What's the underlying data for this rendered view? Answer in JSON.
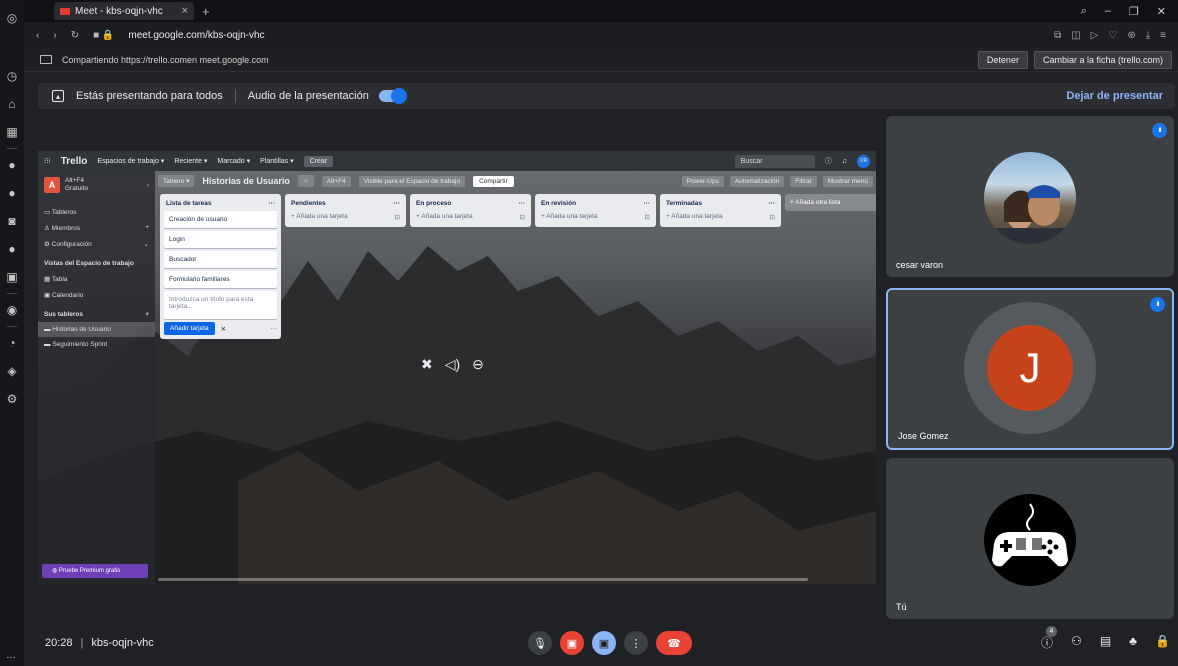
{
  "browser": {
    "tab_title": "Meet - kbs-oqjn-vhc",
    "tab_close": "×",
    "new_tab": "+",
    "url": "meet.google.com/kbs-oqjn-vhc"
  },
  "sharebar": {
    "text": "Compartiendo https://trello.comen meet.google.com",
    "stop_label": "Detener",
    "switch_label": "Cambiar a la ficha (trello.com)"
  },
  "presenting": {
    "text": "Estás presentando para todos",
    "audio_label": "Audio de la presentación",
    "stop_label": "Dejar de presentar"
  },
  "trello": {
    "logo": "Trello",
    "menus": [
      "Espacios de trabajo ▾",
      "Reciente ▾",
      "Marcado ▾",
      "Plantillas ▾"
    ],
    "create": "Crear",
    "search_placeholder": "Buscar",
    "avatar": "OR",
    "workspace": {
      "initial": "A",
      "name": "Alt+F4",
      "plan": "Gratuito"
    },
    "sidebar": {
      "boards": "Tableros",
      "members": "Miembros",
      "settings": "Configuración",
      "views_heading": "Vistas del Espacio de trabajo",
      "table": "Tabla",
      "calendar": "Calendario",
      "your_boards": "Sus tableros",
      "board_items": [
        "Historias de Usuario",
        "Seguimiento Sprint"
      ],
      "premium": "Pruebe Premium gratis"
    },
    "board": {
      "view": "Tablero ▾",
      "title": "Historias de Usuario",
      "workspace_chip": "Alt+F4",
      "visibility": "Visible para el Espacio de trabajo",
      "share": "Compartir",
      "powerups": "Power-Ups",
      "automation": "Automatización",
      "filter": "Filtrar",
      "menu": "Mostrar menú"
    },
    "lists": [
      {
        "title": "Lista de tareas",
        "cards": [
          "Creación de usuario",
          "Login",
          "Buscador",
          "Formulario familiares"
        ],
        "input_placeholder": "Introduzca un título para esta tarjeta...",
        "add_button": "Añadir tarjeta"
      },
      {
        "title": "Pendientes",
        "add": "+ Añada una tarjeta"
      },
      {
        "title": "En proceso",
        "add": "+ Añada una tarjeta"
      },
      {
        "title": "En revisión",
        "add": "+ Añada una tarjeta"
      },
      {
        "title": "Terminadas",
        "add": "+ Añada una tarjeta"
      }
    ],
    "add_list": "+ Añada otra lista"
  },
  "participants": [
    {
      "name": "cesar varon"
    },
    {
      "name": "Jose Gomez",
      "initial": "J"
    },
    {
      "name": "Tú"
    }
  ],
  "meeting": {
    "time": "20:28",
    "code": "kbs-oqjn-vhc",
    "participant_count": "4"
  }
}
